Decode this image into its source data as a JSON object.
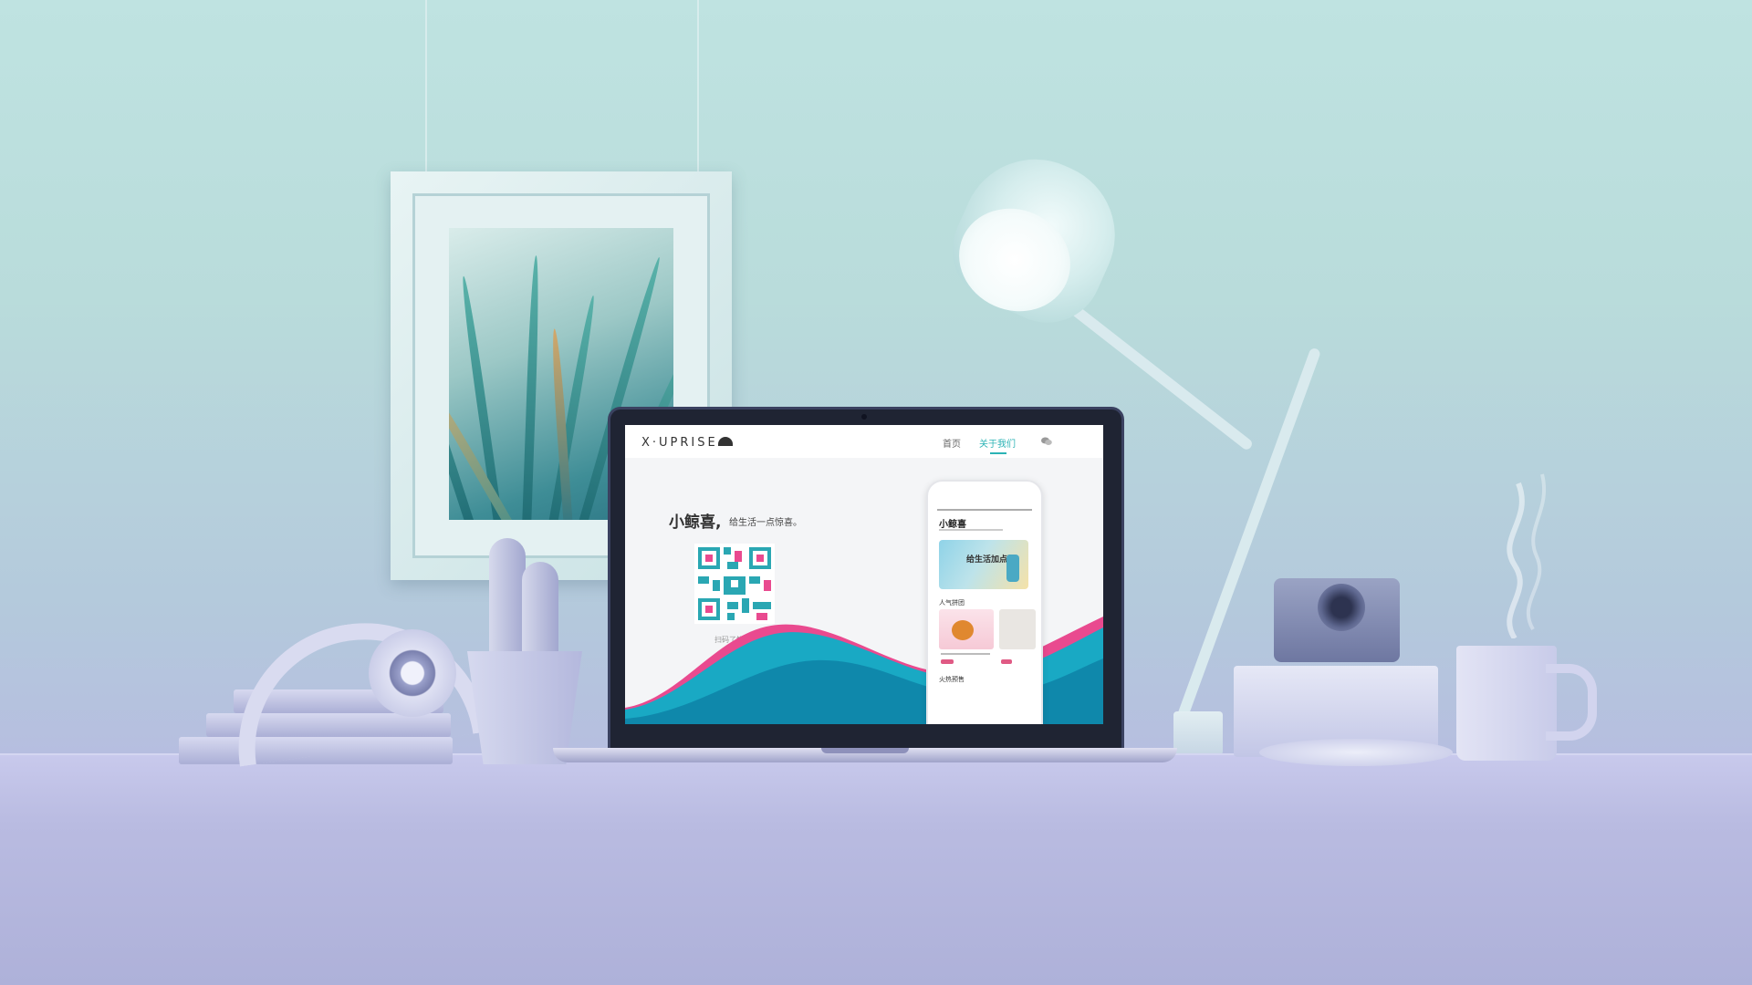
{
  "site": {
    "logo_text": "X·UPRISE",
    "nav": {
      "home": "首页",
      "about": "关于我们"
    },
    "hero": {
      "brand": "小鲸喜,",
      "tagline": "给生活一点惊喜。",
      "qr_caption": "扫码了解更多"
    }
  },
  "phone": {
    "title": "小鲸喜",
    "banner_text": "给生活加点料",
    "section_popular": "人气拼团",
    "section_hot": "火热预售"
  },
  "colors": {
    "accent": "#2bb3b5",
    "wave_teal": "#19a9c4",
    "wave_pink": "#e94a8f",
    "wave_dark": "#0c7fa5"
  },
  "icons": [
    "wechat-icon",
    "whale-logo-icon"
  ]
}
